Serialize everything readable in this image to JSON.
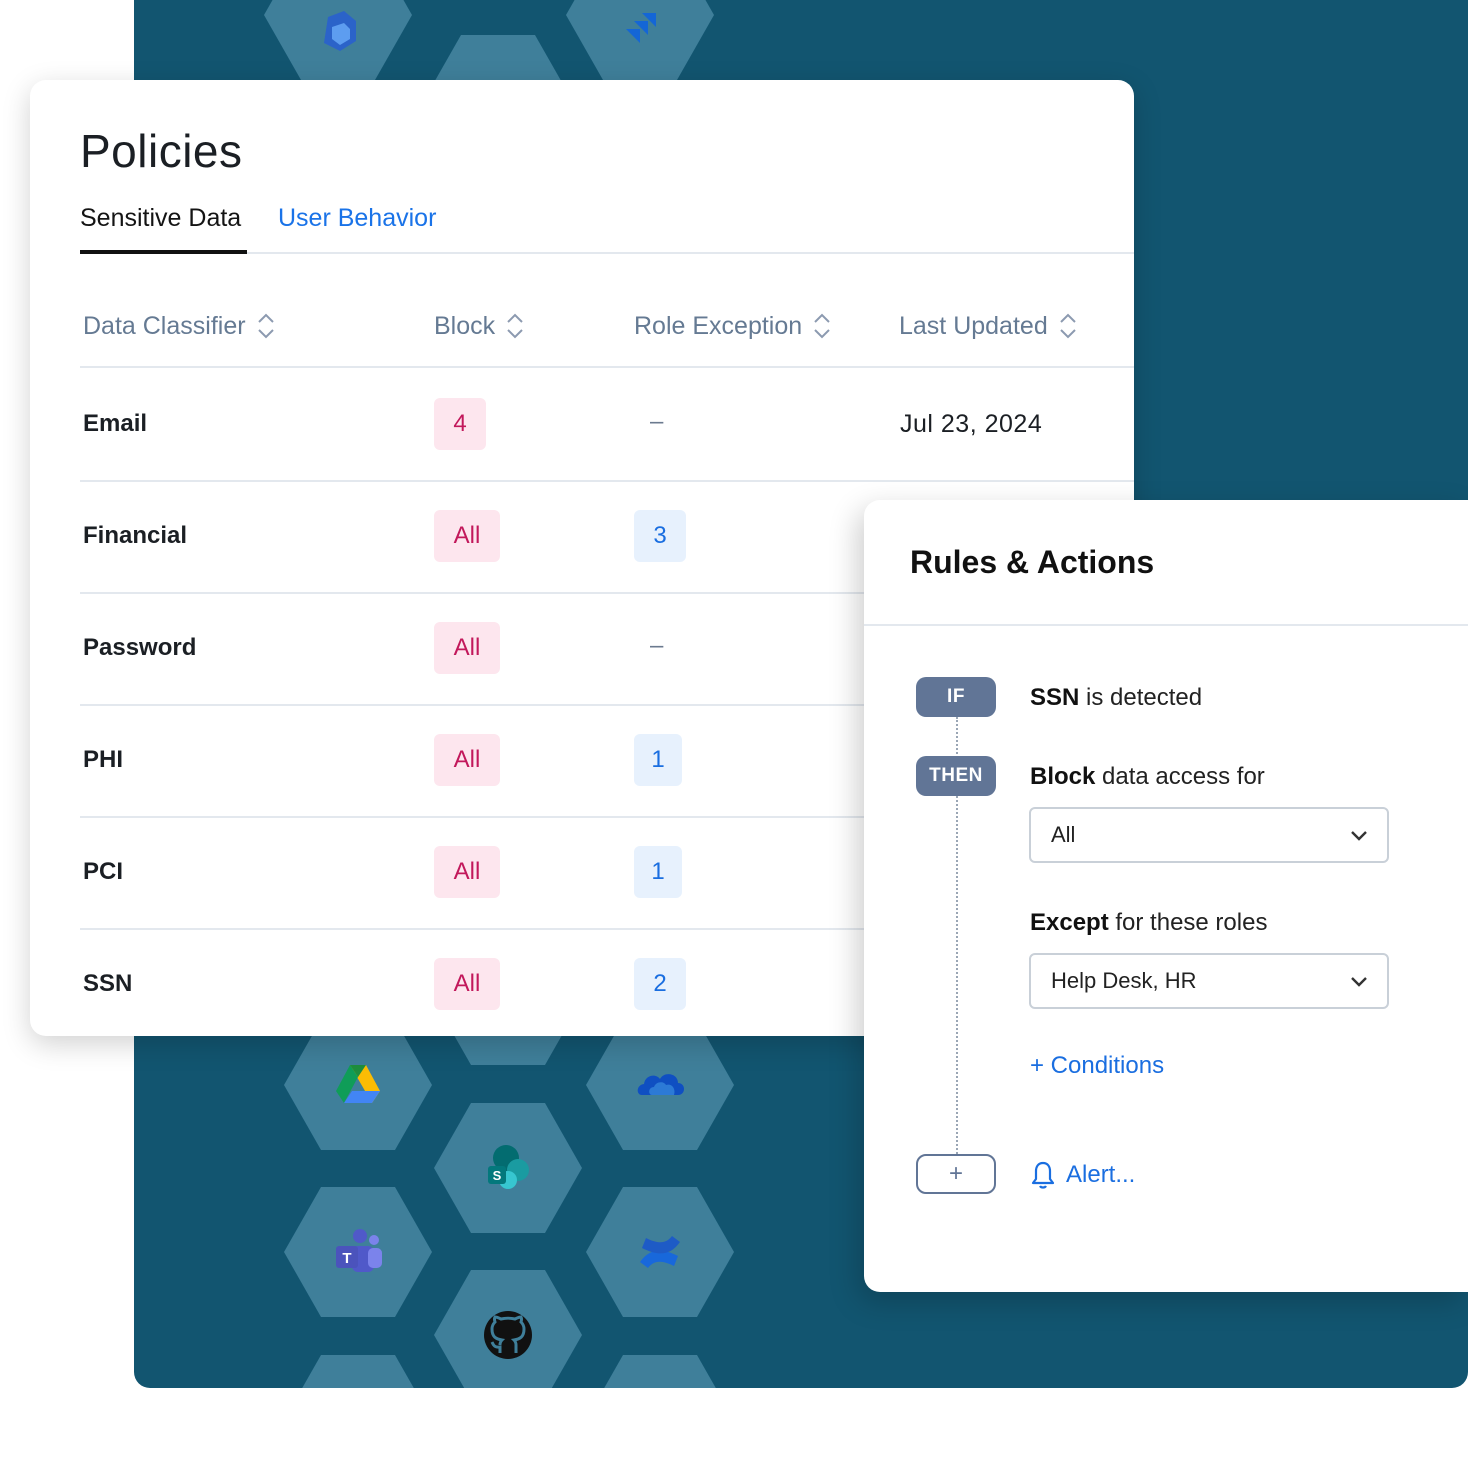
{
  "policies": {
    "title": "Policies",
    "tabs": [
      {
        "label": "Sensitive Data",
        "active": true
      },
      {
        "label": "User Behavior",
        "active": false
      }
    ],
    "columns": [
      "Data Classifier",
      "Block",
      "Role Exception",
      "Last Updated"
    ],
    "rows": [
      {
        "name": "Email",
        "block": "4",
        "role_exception": "–",
        "last_updated": "Jul 23, 2024"
      },
      {
        "name": "Financial",
        "block": "All",
        "role_exception": "3",
        "last_updated": ""
      },
      {
        "name": "Password",
        "block": "All",
        "role_exception": "–",
        "last_updated": ""
      },
      {
        "name": "PHI",
        "block": "All",
        "role_exception": "1",
        "last_updated": ""
      },
      {
        "name": "PCI",
        "block": "All",
        "role_exception": "1",
        "last_updated": ""
      },
      {
        "name": "SSN",
        "block": "All",
        "role_exception": "2",
        "last_updated": ""
      }
    ]
  },
  "rules": {
    "title": "Rules & Actions",
    "if_label": "IF",
    "then_label": "THEN",
    "if_strong": "SSN",
    "if_text": " is detected",
    "then_strong": "Block",
    "then_text": " data access for",
    "access_select": "All",
    "except_strong": "Except",
    "except_text": " for these roles",
    "roles_select": "Help Desk, HR",
    "conditions_link": "+ Conditions",
    "add_symbol": "+",
    "alert_link": "Alert..."
  },
  "integrations": [
    "microsoft-365-icon",
    "jira-icon",
    "google-drive-icon",
    "onedrive-icon",
    "sharepoint-icon",
    "teams-icon",
    "confluence-icon",
    "github-icon"
  ],
  "colors": {
    "background_panel": "#125570",
    "hex": "#3f7f9a",
    "link": "#1a73e8",
    "pill": "#617596",
    "block_badge": "#fde6ee",
    "role_badge": "#e7f1fd"
  }
}
